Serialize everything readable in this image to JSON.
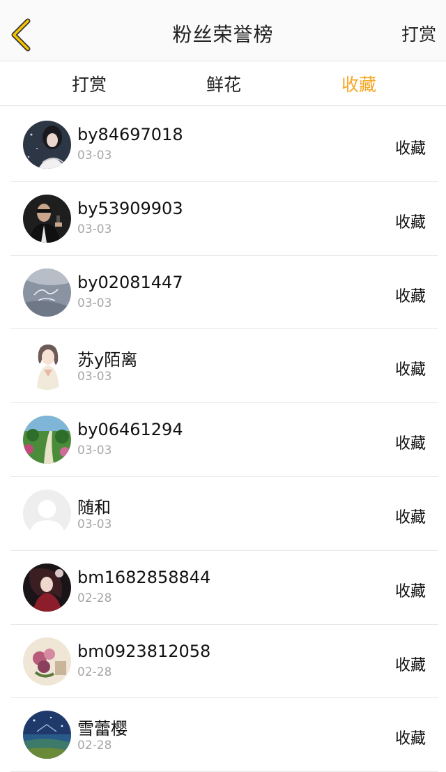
{
  "navbar": {
    "back_icon": "chevron-left-icon",
    "title": "粉丝荣誉榜",
    "action_label": "打赏",
    "accent_color": "#f5a623"
  },
  "tabs": [
    {
      "label": "打赏",
      "active": false
    },
    {
      "label": "鲜花",
      "active": false
    },
    {
      "label": "收藏",
      "active": true
    }
  ],
  "fans": [
    {
      "name": "by84697018",
      "date": "03-03",
      "type": "收藏",
      "avatar": "girl-portrait-avatar"
    },
    {
      "name": "by53909903",
      "date": "03-03",
      "type": "收藏",
      "avatar": "man-with-gun-avatar"
    },
    {
      "name": "by02081447",
      "date": "03-03",
      "type": "收藏",
      "avatar": "hello-autumn-text-avatar"
    },
    {
      "name": "苏y陌离",
      "date": "03-03",
      "type": "收藏",
      "avatar": "anime-girl-avatar"
    },
    {
      "name": "by06461294",
      "date": "03-03",
      "type": "收藏",
      "avatar": "green-landscape-avatar"
    },
    {
      "name": "随和",
      "date": "03-03",
      "type": "收藏",
      "avatar": "default-avatar"
    },
    {
      "name": "bm1682858844",
      "date": "02-28",
      "type": "收藏",
      "avatar": "dark-anime-avatar"
    },
    {
      "name": "bm0923812058",
      "date": "02-28",
      "type": "收藏",
      "avatar": "flowers-avatar"
    },
    {
      "name": "雪蕾樱",
      "date": "02-28",
      "type": "收藏",
      "avatar": "night-sky-avatar"
    }
  ]
}
